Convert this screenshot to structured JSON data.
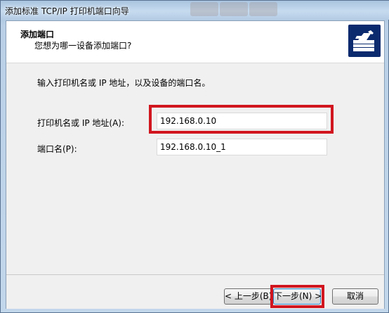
{
  "window": {
    "title": "添加标准 TCP/IP 打印机端口向导"
  },
  "header": {
    "title": "添加端口",
    "subtitle": "您想为哪一设备添加端口?",
    "logo_icon": "printer-network-icon"
  },
  "main": {
    "instruction": "输入打印机名或 IP 地址，以及设备的端口名。",
    "printer_label": "打印机名或 IP 地址(A):",
    "printer_value": "192.168.0.10",
    "port_label": "端口名(P):",
    "port_value": "192.168.0.10_1"
  },
  "buttons": {
    "back": "< 上一步(B)",
    "next": "下一步(N) >",
    "cancel": "取消"
  },
  "colors": {
    "highlight": "#d1161f",
    "logo_bg": "#0b2a6e"
  }
}
